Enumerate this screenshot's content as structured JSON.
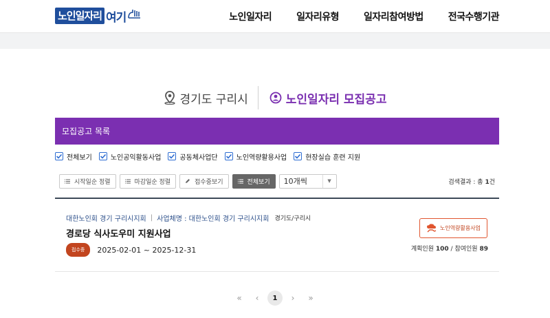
{
  "header": {
    "logo": {
      "main": "노인일자리",
      "accent": "여기"
    },
    "nav": [
      "노인일자리",
      "일자리유형",
      "일자리참여방법",
      "전국수행기관"
    ]
  },
  "title": {
    "location": "경기도 구리시",
    "heading": "노인일자리 모집공고"
  },
  "list_bar": {
    "label": "모집공고 목록"
  },
  "filters": [
    "전체보기",
    "노인공익활동사업",
    "공동체사업단",
    "노인역량활용사업",
    "현장실습 훈련 지원"
  ],
  "tools": {
    "sort_start": "시작일순 정렬",
    "sort_end": "마감일순 정렬",
    "open_only": "접수중보기",
    "view_all": "전체보기",
    "page_size": "10개씩"
  },
  "result": {
    "prefix": "검색결과 : 총",
    "count": "1",
    "suffix": "건"
  },
  "job": {
    "org": "대한노인회 경기 구리시지회",
    "sep": "|",
    "operator": "사업체명 : 대한노인회 경기 구리시지회",
    "region": "경기도/구리시",
    "title": "경로당 식사도우미 지원사업",
    "status": "접수중",
    "period": "2025-02-01 ~ 2025-12-31",
    "type": "노인역량활용사업",
    "planned_label": "계획인원",
    "planned": "100",
    "count_sep": "/",
    "joined_label": "참여인원",
    "joined": "89"
  },
  "pager": {
    "first": "«",
    "prev": "‹",
    "current": "1",
    "next": "›",
    "last": "»"
  },
  "colors": {
    "accent": "#7b2fb1",
    "logo": "#1f4e9c",
    "badge": "#c2451f"
  },
  "icons": {
    "location": "location-pin-icon",
    "recruit": "user-circle-icon",
    "type": "cloud-hand-icon"
  }
}
